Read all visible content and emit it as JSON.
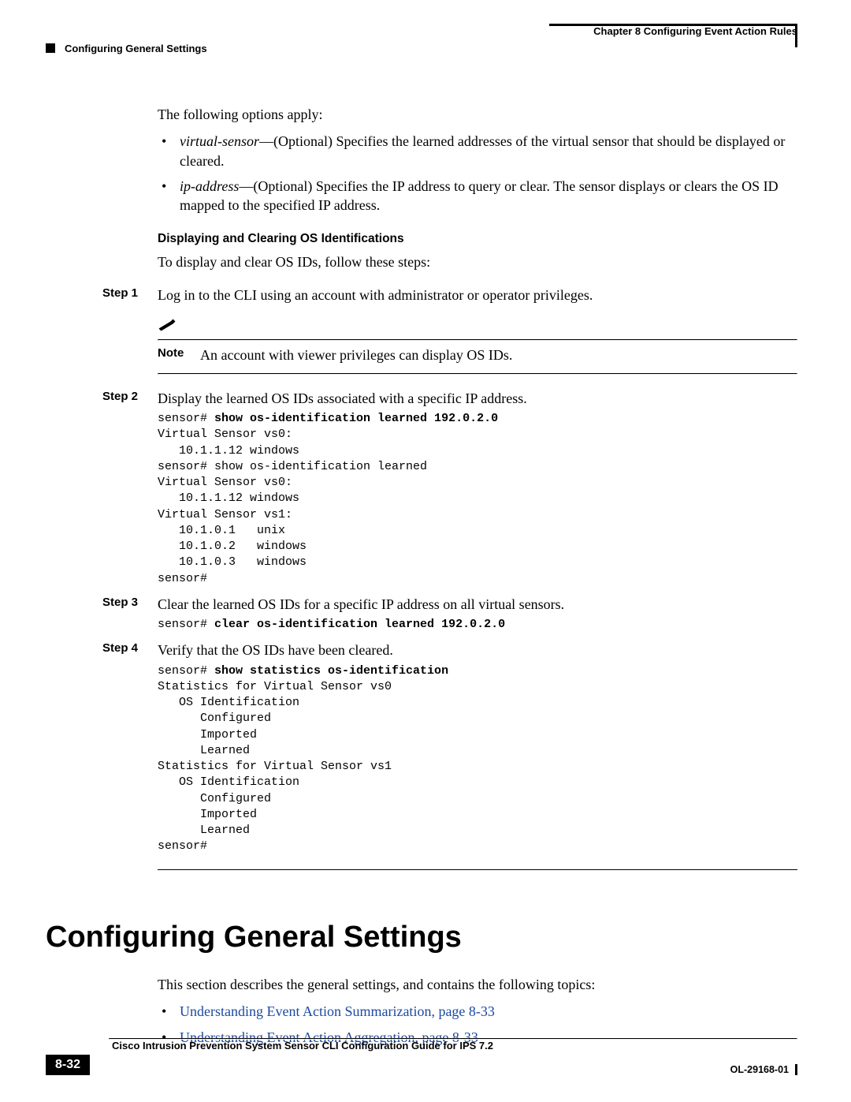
{
  "running_head": {
    "chapter": "Chapter 8      Configuring Event Action Rules",
    "section": "Configuring General Settings"
  },
  "body": {
    "intro": "The following options apply:",
    "opt1_term": "virtual-sensor",
    "opt1_rest": "—(Optional) Specifies the learned addresses of the virtual sensor that should be displayed or cleared.",
    "opt2_term": "ip-address",
    "opt2_rest": "—(Optional) Specifies the IP address to query or clear. The sensor displays or clears the OS ID mapped to the specified IP address.",
    "sub": "Displaying and Clearing OS Identifications",
    "sub_after": "To display and clear OS IDs, follow these steps:",
    "step1_label": "Step 1",
    "step1_text": "Log in to the CLI using an account with administrator or operator privileges.",
    "note_word": "Note",
    "note_text": "An account with viewer privileges can display OS IDs.",
    "step2_label": "Step 2",
    "step2_text": "Display the learned OS IDs associated with a specific IP address.",
    "code2_prompt": "sensor# ",
    "code2_cmd": "show os-identification learned 192.0.2.0",
    "code2_rest": "Virtual Sensor vs0:\n   10.1.1.12 windows\nsensor# show os-identification learned\nVirtual Sensor vs0:\n   10.1.1.12 windows\nVirtual Sensor vs1:\n   10.1.0.1   unix \n   10.1.0.2   windows \n   10.1.0.3   windows \nsensor#",
    "step3_label": "Step 3",
    "step3_text": "Clear the learned OS IDs for a specific IP address on all virtual sensors.",
    "code3_prompt": "sensor# ",
    "code3_cmd": "clear os-identification learned 192.0.2.0",
    "step4_label": "Step 4",
    "step4_text": "Verify that the OS IDs have been cleared.",
    "code4_prompt": "sensor# ",
    "code4_cmd": "show statistics os-identification",
    "code4_rest": "Statistics for Virtual Sensor vs0\n   OS Identification\n      Configured\n      Imported\n      Learned\nStatistics for Virtual Sensor vs1\n   OS Identification\n      Configured\n      Imported\n      Learned\nsensor#",
    "h1": "Configuring General Settings",
    "h1_after": "This section describes the general settings, and contains the following topics:",
    "link1": "Understanding Event Action Summarization, page 8-33",
    "link2": "Understanding Event Action Aggregation, page 8-33"
  },
  "footer": {
    "title": "Cisco Intrusion Prevention System Sensor CLI Configuration Guide for IPS 7.2",
    "page": "8-32",
    "doc_id": "OL-29168-01"
  }
}
